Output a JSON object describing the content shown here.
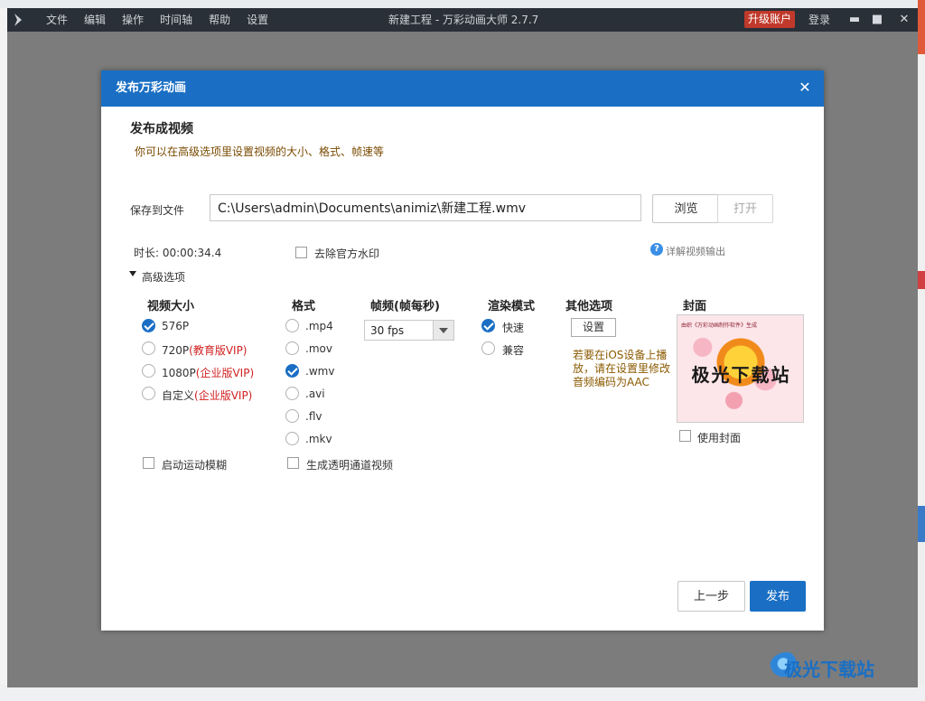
{
  "app": {
    "menu": [
      "文件",
      "编辑",
      "操作",
      "时间轴",
      "帮助",
      "设置"
    ],
    "title": "新建工程 - 万彩动画大师 2.7.7",
    "upgrade": "升级账户",
    "login": "登录"
  },
  "dialog": {
    "title": "发布万彩动画",
    "close": "✕",
    "section_title": "发布成视频",
    "section_sub": "你可以在高级选项里设置视频的大小、格式、帧速等",
    "save_label": "保存到文件",
    "save_path": "C:\\Users\\admin\\Documents\\animiz\\新建工程.wmv",
    "browse": "浏览",
    "open": "打开",
    "duration": "时长: 00:00:34.4",
    "watermark_opt": "去除官方水印",
    "help_link": "详解视频输出",
    "advanced": "高级选项",
    "size": {
      "heading": "视频大小",
      "options": [
        {
          "label": "576P",
          "vip": "",
          "checked": true
        },
        {
          "label": "720P",
          "vip": "(教育版VIP)",
          "checked": false
        },
        {
          "label": "1080P",
          "vip": "(企业版VIP)",
          "checked": false
        },
        {
          "label": "自定义",
          "vip": "(企业版VIP)",
          "checked": false
        }
      ],
      "motion_blur": "启动运动模糊"
    },
    "format": {
      "heading": "格式",
      "options": [
        ".mp4",
        ".mov",
        ".wmv",
        ".avi",
        ".flv",
        ".mkv"
      ],
      "selected": ".wmv",
      "alpha": "生成透明通道视频"
    },
    "fps": {
      "heading": "帧频(帧每秒)",
      "value": "30 fps"
    },
    "render": {
      "heading": "渲染模式",
      "options": [
        "快速",
        "兼容"
      ],
      "selected": "快速"
    },
    "other": {
      "heading": "其他选项",
      "settings": "设置",
      "note": "若要在iOS设备上播放，请在设置里修改音频编码为AAC"
    },
    "cover": {
      "heading": "封面",
      "image_text": "极光下载站",
      "image_small": "由织《万彩动画制作软件》生成",
      "use_cover": "使用封面"
    },
    "prev": "上一步",
    "publish": "发布"
  },
  "watermark": "极光下载站"
}
